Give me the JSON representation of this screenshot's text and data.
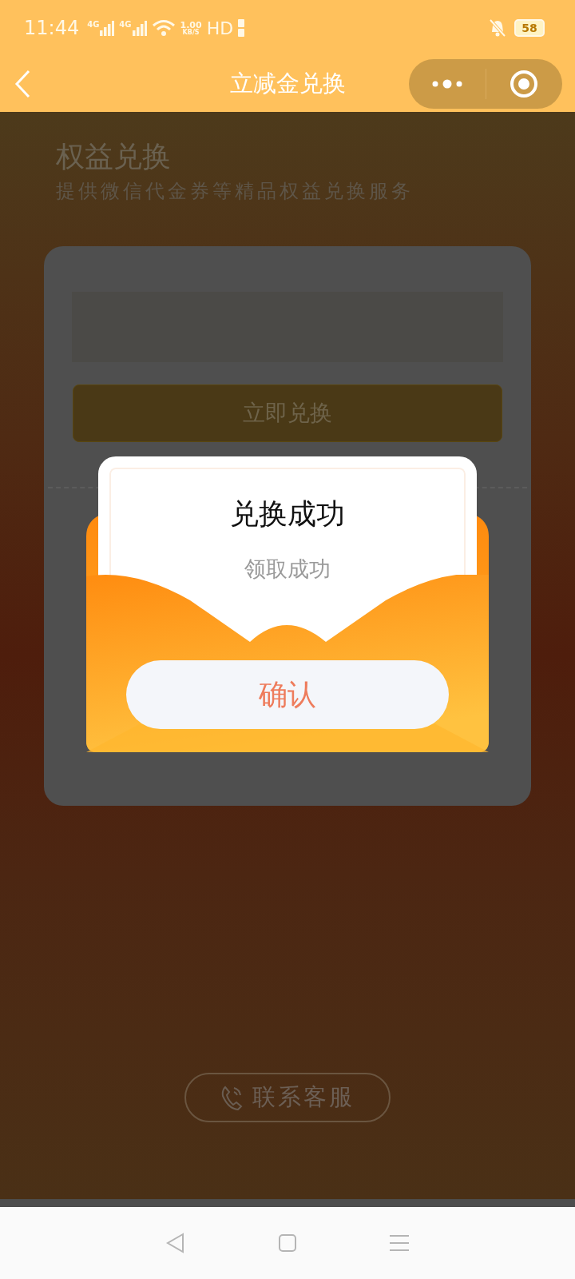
{
  "status_bar": {
    "time": "11:44",
    "sim_labels": [
      "4G",
      "4G"
    ],
    "speed_value": "1.00",
    "speed_unit": "KB/S",
    "hd": "HD",
    "battery": "58"
  },
  "nav_bar": {
    "title": "立减金兑换"
  },
  "page": {
    "heading": "权益兑换",
    "subtitle": "提供微信代金券等精品权益兑换服务",
    "redeem_button": "立即兑换",
    "contact_button": "联系客服"
  },
  "dialog": {
    "title": "兑换成功",
    "message": "领取成功",
    "confirm_button": "确认"
  }
}
